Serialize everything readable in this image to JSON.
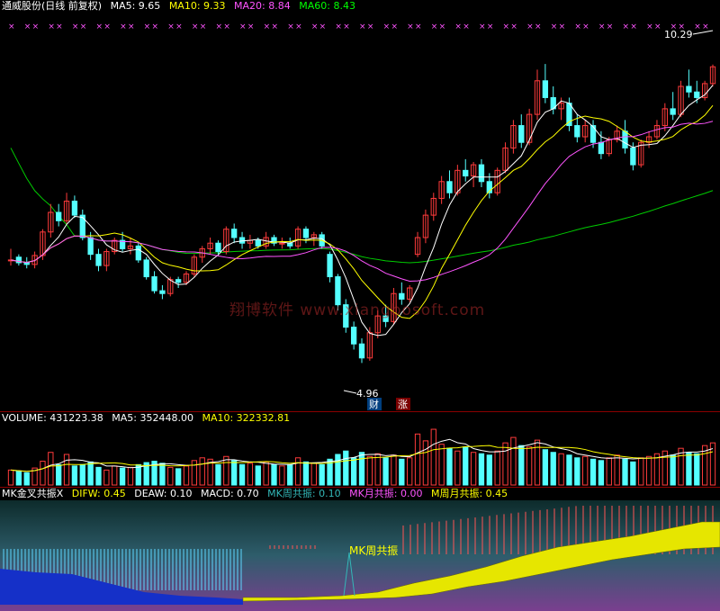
{
  "header": {
    "title": "通威股份(日线 前复权)",
    "ma5": "MA5: 9.65",
    "ma10": "MA10: 9.33",
    "ma20": "MA20: 8.84",
    "ma60": "MA60: 8.43"
  },
  "price_panel": {
    "high_label": "10.29",
    "low_label": "4.96",
    "marker_cai": "财",
    "marker_zhang": "涨",
    "watermark": "翔博软件 www.xiangbosoft.com"
  },
  "volume_header": {
    "volume": "VOLUME: 431223.38",
    "ma5": "MA5: 352448.00",
    "ma10": "MA10: 322332.81"
  },
  "indicator_header": {
    "name": "MK金叉共振X",
    "difw": "DIFW: 0.45",
    "deaw": "DEAW: 0.10",
    "macd": "MACD: 0.70",
    "mk_week": "MK周共振: 0.10",
    "mk_month": "MK月共振: 0.00",
    "m_week_month": "M周月共振: 0.45"
  },
  "indicator_panel": {
    "resonance_label": "MK周共振"
  },
  "colors": {
    "up": "#ff3b3b",
    "down": "#54ffff",
    "ma5": "#ffffff",
    "ma10": "#ffff00",
    "ma20": "#ff55ff",
    "ma60": "#00cc00",
    "text_white": "#ffffff",
    "text_yellow": "#ffff00",
    "text_magenta": "#ff55ff",
    "text_green": "#00ff00",
    "text_teal": "#33b8b8"
  },
  "chart_data": [
    {
      "type": "candlestick",
      "title": "通威股份(日线 前复权)",
      "y_range": [
        4.5,
        10.8
      ],
      "annotations": [
        {
          "label": "10.29",
          "value": 10.29
        },
        {
          "label": "4.96",
          "value": 4.96
        }
      ],
      "ohlc": [
        [
          6.8,
          7.0,
          6.7,
          6.8
        ],
        [
          6.85,
          6.9,
          6.7,
          6.75
        ],
        [
          6.75,
          6.85,
          6.65,
          6.72
        ],
        [
          6.72,
          6.95,
          6.65,
          6.88
        ],
        [
          6.88,
          7.35,
          6.8,
          7.3
        ],
        [
          7.3,
          7.8,
          7.2,
          7.65
        ],
        [
          7.65,
          7.8,
          7.4,
          7.5
        ],
        [
          7.5,
          8.0,
          7.45,
          7.85
        ],
        [
          7.85,
          7.95,
          7.55,
          7.6
        ],
        [
          7.6,
          7.7,
          7.15,
          7.2
        ],
        [
          7.2,
          7.3,
          6.8,
          6.9
        ],
        [
          6.9,
          7.0,
          6.6,
          6.7
        ],
        [
          6.7,
          7.0,
          6.6,
          6.95
        ],
        [
          6.95,
          7.2,
          6.9,
          7.15
        ],
        [
          7.15,
          7.3,
          6.95,
          7.0
        ],
        [
          7.0,
          7.2,
          6.9,
          7.05
        ],
        [
          7.05,
          7.1,
          6.75,
          6.8
        ],
        [
          6.8,
          6.85,
          6.45,
          6.5
        ],
        [
          6.5,
          6.6,
          6.2,
          6.25
        ],
        [
          6.25,
          6.35,
          6.1,
          6.2
        ],
        [
          6.2,
          6.5,
          6.15,
          6.45
        ],
        [
          6.45,
          6.5,
          6.3,
          6.4
        ],
        [
          6.4,
          6.6,
          6.35,
          6.55
        ],
        [
          6.55,
          6.9,
          6.5,
          6.85
        ],
        [
          6.85,
          7.05,
          6.75,
          7.0
        ],
        [
          7.0,
          7.2,
          6.9,
          7.1
        ],
        [
          7.1,
          7.15,
          6.9,
          6.95
        ],
        [
          6.95,
          7.4,
          6.9,
          7.35
        ],
        [
          7.35,
          7.45,
          7.1,
          7.2
        ],
        [
          7.2,
          7.3,
          7.0,
          7.1
        ],
        [
          7.1,
          7.25,
          7.0,
          7.15
        ],
        [
          7.15,
          7.2,
          7.0,
          7.05
        ],
        [
          7.05,
          7.3,
          7.0,
          7.2
        ],
        [
          7.2,
          7.25,
          7.05,
          7.1
        ],
        [
          7.1,
          7.2,
          7.0,
          7.1
        ],
        [
          7.1,
          7.2,
          7.0,
          7.05
        ],
        [
          7.05,
          7.4,
          7.0,
          7.35
        ],
        [
          7.35,
          7.4,
          7.1,
          7.2
        ],
        [
          7.2,
          7.3,
          7.05,
          7.25
        ],
        [
          7.25,
          7.3,
          7.0,
          7.05
        ],
        [
          6.9,
          6.95,
          6.4,
          6.5
        ],
        [
          6.5,
          6.55,
          5.9,
          6.0
        ],
        [
          6.0,
          6.1,
          5.5,
          5.6
        ],
        [
          5.6,
          5.7,
          5.2,
          5.3
        ],
        [
          5.3,
          5.4,
          4.96,
          5.05
        ],
        [
          5.05,
          5.6,
          5.0,
          5.5
        ],
        [
          5.5,
          5.9,
          5.4,
          5.8
        ],
        [
          5.8,
          6.0,
          5.6,
          5.7
        ],
        [
          5.7,
          6.3,
          5.65,
          6.2
        ],
        [
          6.2,
          6.4,
          6.0,
          6.1
        ],
        [
          6.1,
          6.35,
          6.05,
          6.3
        ],
        [
          6.9,
          7.3,
          6.85,
          7.2
        ],
        [
          7.2,
          7.7,
          7.1,
          7.6
        ],
        [
          7.6,
          8.0,
          7.5,
          7.9
        ],
        [
          7.9,
          8.3,
          7.8,
          8.2
        ],
        [
          8.2,
          8.4,
          7.9,
          8.0
        ],
        [
          8.0,
          8.5,
          7.95,
          8.4
        ],
        [
          8.4,
          8.6,
          8.2,
          8.3
        ],
        [
          8.3,
          8.55,
          8.1,
          8.5
        ],
        [
          8.5,
          8.6,
          8.1,
          8.2
        ],
        [
          8.2,
          8.35,
          7.9,
          8.0
        ],
        [
          8.0,
          8.45,
          7.95,
          8.4
        ],
        [
          8.4,
          8.9,
          8.35,
          8.8
        ],
        [
          8.8,
          9.3,
          8.7,
          9.2
        ],
        [
          9.2,
          9.4,
          8.8,
          8.9
        ],
        [
          8.9,
          9.5,
          8.85,
          9.4
        ],
        [
          9.4,
          10.2,
          9.3,
          10.0
        ],
        [
          10.0,
          10.3,
          9.6,
          9.7
        ],
        [
          9.7,
          9.9,
          9.4,
          9.5
        ],
        [
          9.5,
          9.7,
          9.3,
          9.6
        ],
        [
          9.6,
          9.7,
          9.1,
          9.2
        ],
        [
          9.2,
          9.4,
          8.9,
          9.0
        ],
        [
          9.0,
          9.3,
          8.9,
          9.2
        ],
        [
          9.2,
          9.3,
          8.8,
          8.9
        ],
        [
          8.9,
          9.1,
          8.6,
          8.7
        ],
        [
          8.7,
          9.0,
          8.65,
          8.95
        ],
        [
          8.95,
          9.2,
          8.9,
          9.1
        ],
        [
          9.1,
          9.3,
          8.7,
          8.8
        ],
        [
          8.8,
          8.9,
          8.4,
          8.5
        ],
        [
          8.5,
          8.95,
          8.45,
          8.9
        ],
        [
          8.9,
          9.1,
          8.8,
          9.0
        ],
        [
          9.0,
          9.3,
          8.95,
          9.2
        ],
        [
          9.2,
          9.6,
          9.1,
          9.5
        ],
        [
          9.5,
          9.8,
          9.3,
          9.4
        ],
        [
          9.4,
          10.0,
          9.35,
          9.9
        ],
        [
          9.9,
          10.2,
          9.7,
          9.8
        ],
        [
          9.8,
          10.0,
          9.6,
          9.7
        ],
        [
          9.7,
          10.0,
          9.65,
          9.95
        ],
        [
          9.95,
          10.29,
          9.9,
          10.25
        ]
      ]
    },
    {
      "type": "bar",
      "title": "VOLUME",
      "values": [
        22,
        20,
        18,
        25,
        35,
        48,
        30,
        45,
        28,
        30,
        34,
        26,
        22,
        28,
        25,
        26,
        30,
        33,
        35,
        32,
        26,
        24,
        28,
        36,
        40,
        38,
        30,
        42,
        36,
        30,
        32,
        28,
        34,
        30,
        28,
        30,
        40,
        34,
        32,
        30,
        38,
        45,
        50,
        40,
        48,
        42,
        46,
        40,
        44,
        38,
        40,
        75,
        65,
        82,
        60,
        54,
        50,
        56,
        48,
        46,
        44,
        50,
        62,
        70,
        58,
        56,
        66,
        52,
        48,
        46,
        44,
        40,
        42,
        38,
        36,
        40,
        44,
        38,
        34,
        40,
        42,
        46,
        50,
        44,
        54,
        48,
        46,
        58,
        62
      ]
    }
  ]
}
